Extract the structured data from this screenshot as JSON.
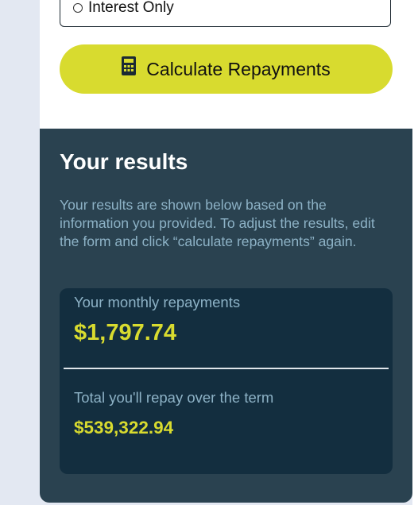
{
  "form": {
    "repayment_type_option": "Interest Only",
    "calculate_button_label": "Calculate Repayments"
  },
  "results": {
    "title": "Your results",
    "description": "Your results are shown below based on the information you provided. To adjust the results, edit the form and click “calculate repayments” again.",
    "monthly_label": "Your monthly repayments",
    "monthly_value": "$1,797.74",
    "total_label": "Total you'll repay over the term",
    "total_value": "$539,322.94"
  },
  "colors": {
    "accent": "#d8db2f",
    "results_bg": "#2a4250",
    "summary_bg": "#132e3f",
    "muted_text": "#8db2c6"
  }
}
